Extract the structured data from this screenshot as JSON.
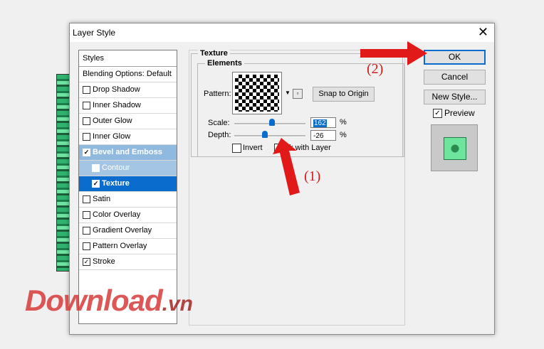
{
  "window": {
    "title": "Layer Style"
  },
  "styles": {
    "header": "Styles",
    "blending": "Blending Options: Default",
    "items": [
      {
        "label": "Drop Shadow",
        "checked": false
      },
      {
        "label": "Inner Shadow",
        "checked": false
      },
      {
        "label": "Outer Glow",
        "checked": false
      },
      {
        "label": "Inner Glow",
        "checked": false
      },
      {
        "label": "Bevel and Emboss",
        "checked": true
      },
      {
        "label": "Contour",
        "checked": false
      },
      {
        "label": "Texture",
        "checked": true
      },
      {
        "label": "Satin",
        "checked": false
      },
      {
        "label": "Color Overlay",
        "checked": false
      },
      {
        "label": "Gradient Overlay",
        "checked": false
      },
      {
        "label": "Pattern Overlay",
        "checked": false
      },
      {
        "label": "Stroke",
        "checked": true
      }
    ]
  },
  "texture": {
    "section_title": "Texture",
    "elements_title": "Elements",
    "pattern_label": "Pattern:",
    "snap_button": "Snap to Origin",
    "scale_label": "Scale:",
    "scale_value": "162",
    "depth_label": "Depth:",
    "depth_value": "-26",
    "percent": "%",
    "invert_label": "Invert",
    "link_label": "nk with Layer"
  },
  "buttons": {
    "ok": "OK",
    "cancel": "Cancel",
    "new_style": "New Style...",
    "preview": "Preview",
    "preview_checked": true
  },
  "annotations": {
    "one": "(1)",
    "two": "(2)"
  },
  "watermark": {
    "main": "Download",
    "suffix": ".vn"
  },
  "colors": {
    "accent": "#0a6ccc",
    "annotation": "#d21d1d"
  }
}
